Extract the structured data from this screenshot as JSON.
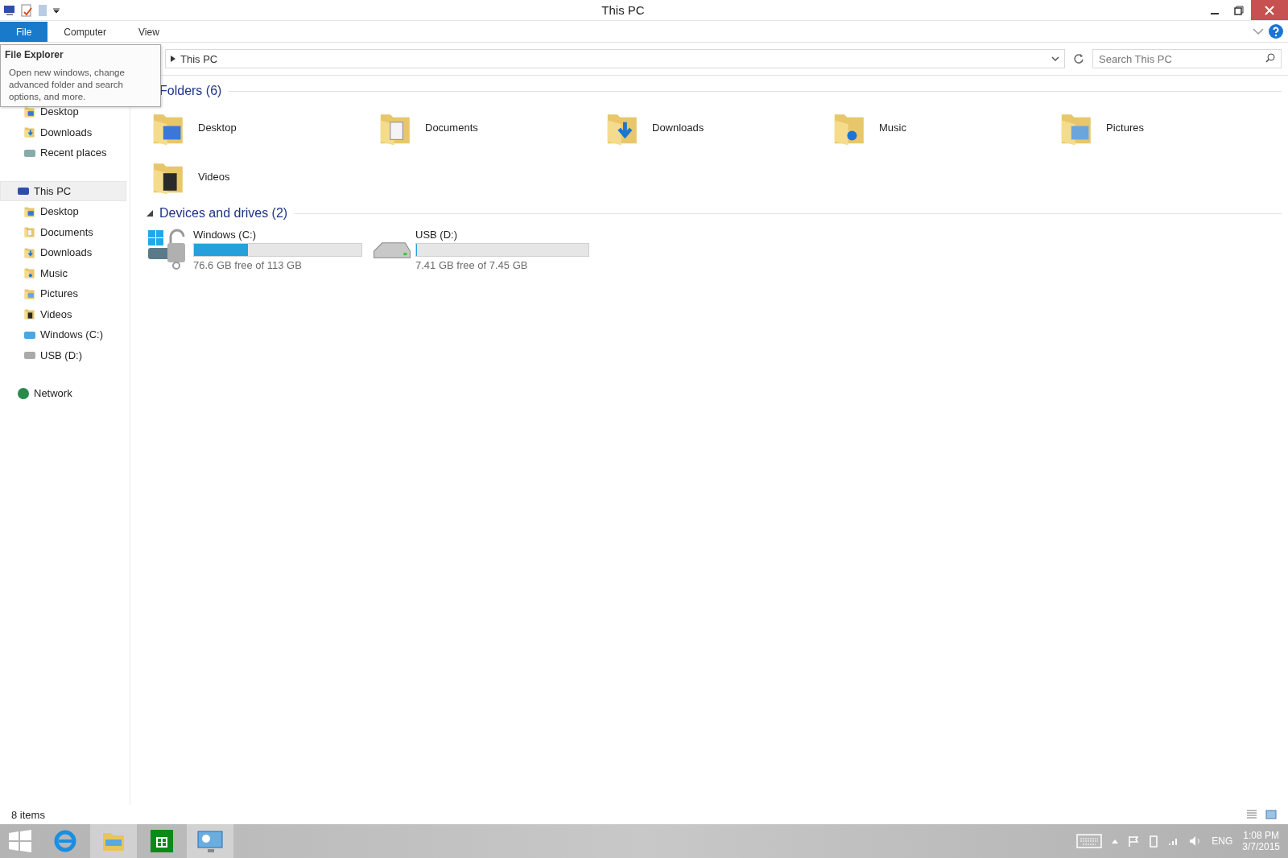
{
  "window": {
    "title": "This PC"
  },
  "ribbon": {
    "tabs": [
      {
        "label": "File",
        "selected": true
      },
      {
        "label": "Computer",
        "selected": false
      },
      {
        "label": "View",
        "selected": false
      }
    ]
  },
  "tooltip": {
    "title": "File Explorer",
    "text": "Open new windows, change advanced folder and search options, and more."
  },
  "address": {
    "path": "This PC"
  },
  "search": {
    "placeholder": "Search This PC"
  },
  "navigation": {
    "favorites": [
      {
        "label": "Desktop",
        "kind": "desktop"
      },
      {
        "label": "Downloads",
        "kind": "downloads"
      },
      {
        "label": "Recent places",
        "kind": "recent"
      }
    ],
    "this_pc": {
      "label": "This PC",
      "selected": true,
      "children": [
        {
          "label": "Desktop",
          "kind": "desktop"
        },
        {
          "label": "Documents",
          "kind": "documents"
        },
        {
          "label": "Downloads",
          "kind": "downloads"
        },
        {
          "label": "Music",
          "kind": "music"
        },
        {
          "label": "Pictures",
          "kind": "pictures"
        },
        {
          "label": "Videos",
          "kind": "videos"
        },
        {
          "label": "Windows (C:)",
          "kind": "system"
        },
        {
          "label": "USB (D:)",
          "kind": "usb"
        }
      ]
    },
    "network": {
      "label": "Network"
    }
  },
  "folders": {
    "title": "Folders (6)",
    "items": [
      {
        "label": "Desktop",
        "kind": "desktop"
      },
      {
        "label": "Documents",
        "kind": "documents"
      },
      {
        "label": "Downloads",
        "kind": "downloads"
      },
      {
        "label": "Music",
        "kind": "music"
      },
      {
        "label": "Pictures",
        "kind": "pictures"
      },
      {
        "label": "Videos",
        "kind": "videos"
      }
    ]
  },
  "drives": {
    "title": "Devices and drives (2)",
    "expanded": true,
    "items": [
      {
        "label": "Windows (C:)",
        "kind": "system",
        "level": 0.32,
        "free": "76.6 GB free of 113 GB"
      },
      {
        "label": "USB (D:)",
        "kind": "usb",
        "level": 0.005,
        "free": "7.41 GB free of 7.45 GB"
      }
    ]
  },
  "status_bar": {
    "count": "8 items"
  },
  "taskbar": {
    "apps": [
      {
        "kind": "browser",
        "selected": false
      },
      {
        "kind": "explorer",
        "selected": true
      },
      {
        "kind": "store",
        "selected": false
      },
      {
        "kind": "control",
        "selected": true
      }
    ],
    "language": "ENG",
    "time": "1:08 PM",
    "date": "3/7/2015"
  }
}
